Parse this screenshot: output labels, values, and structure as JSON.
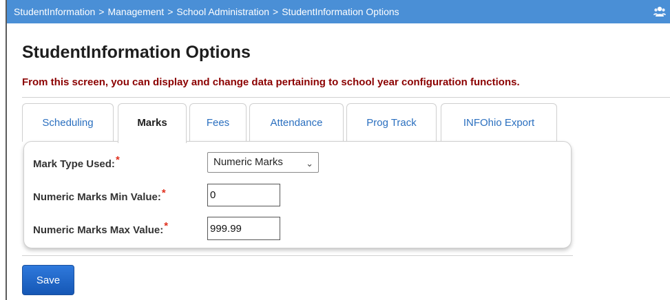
{
  "breadcrumb": {
    "items": [
      "StudentInformation",
      "Management",
      "School Administration",
      "StudentInformation Options"
    ],
    "separator": ">"
  },
  "header_icon": "people-icon",
  "page": {
    "title": "StudentInformation Options",
    "instructions": "From this screen, you can display and change data pertaining to school year configuration functions."
  },
  "tabs": [
    {
      "label": "Scheduling",
      "active": false
    },
    {
      "label": "Marks",
      "active": true
    },
    {
      "label": "Fees",
      "active": false
    },
    {
      "label": "Attendance",
      "active": false
    },
    {
      "label": "Prog Track",
      "active": false
    },
    {
      "label": "INFOhio Export",
      "active": false
    }
  ],
  "form": {
    "mark_type": {
      "label": "Mark Type Used:",
      "value": "Numeric Marks",
      "required": true
    },
    "min_value": {
      "label": "Numeric Marks Min Value:",
      "value": "0",
      "required": true
    },
    "max_value": {
      "label": "Numeric Marks Max Value:",
      "value": "999.99",
      "required": true
    },
    "required_marker": "*"
  },
  "actions": {
    "save_label": "Save"
  },
  "colors": {
    "breadcrumb_bg": "#4a8fd6",
    "instructions_text": "#8b0000",
    "required_marker": "#e0301e",
    "tab_link": "#2a6fbf",
    "save_button": "#1f66c9"
  }
}
